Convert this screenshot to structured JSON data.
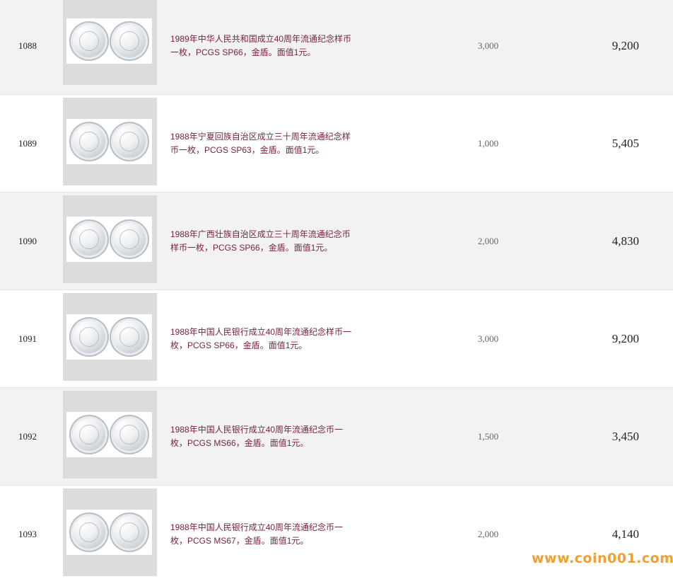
{
  "rows": [
    {
      "lot": "1088",
      "description": "1989年中华人民共和国成立40周年流通纪念样币一枚，PCGS SP66，金盾。面值1元。",
      "estimate": "3,000",
      "price": "9,200",
      "shaded": true
    },
    {
      "lot": "1089",
      "description": "1988年宁夏回族自治区成立三十周年流通纪念样币一枚，PCGS SP63，金盾。面值1元。",
      "estimate": "1,000",
      "price": "5,405",
      "shaded": false
    },
    {
      "lot": "1090",
      "description": "1988年广西壮族自治区成立三十周年流通纪念币样币一枚，PCGS SP66，金盾。面值1元。",
      "estimate": "2,000",
      "price": "4,830",
      "shaded": true
    },
    {
      "lot": "1091",
      "description": "1988年中国人民银行成立40周年流通纪念样币一枚，PCGS SP66，金盾。面值1元。",
      "estimate": "3,000",
      "price": "9,200",
      "shaded": false
    },
    {
      "lot": "1092",
      "description": "1988年中国人民银行成立40周年流通纪念币一枚，PCGS MS66，金盾。面值1元。",
      "estimate": "1,500",
      "price": "3,450",
      "shaded": true
    },
    {
      "lot": "1093",
      "description": "1988年中国人民银行成立40周年流通纪念币一枚，PCGS MS67，金盾。面值1元。",
      "estimate": "2,000",
      "price": "4,140",
      "shaded": false
    }
  ],
  "watermark": "www.coin001.com"
}
